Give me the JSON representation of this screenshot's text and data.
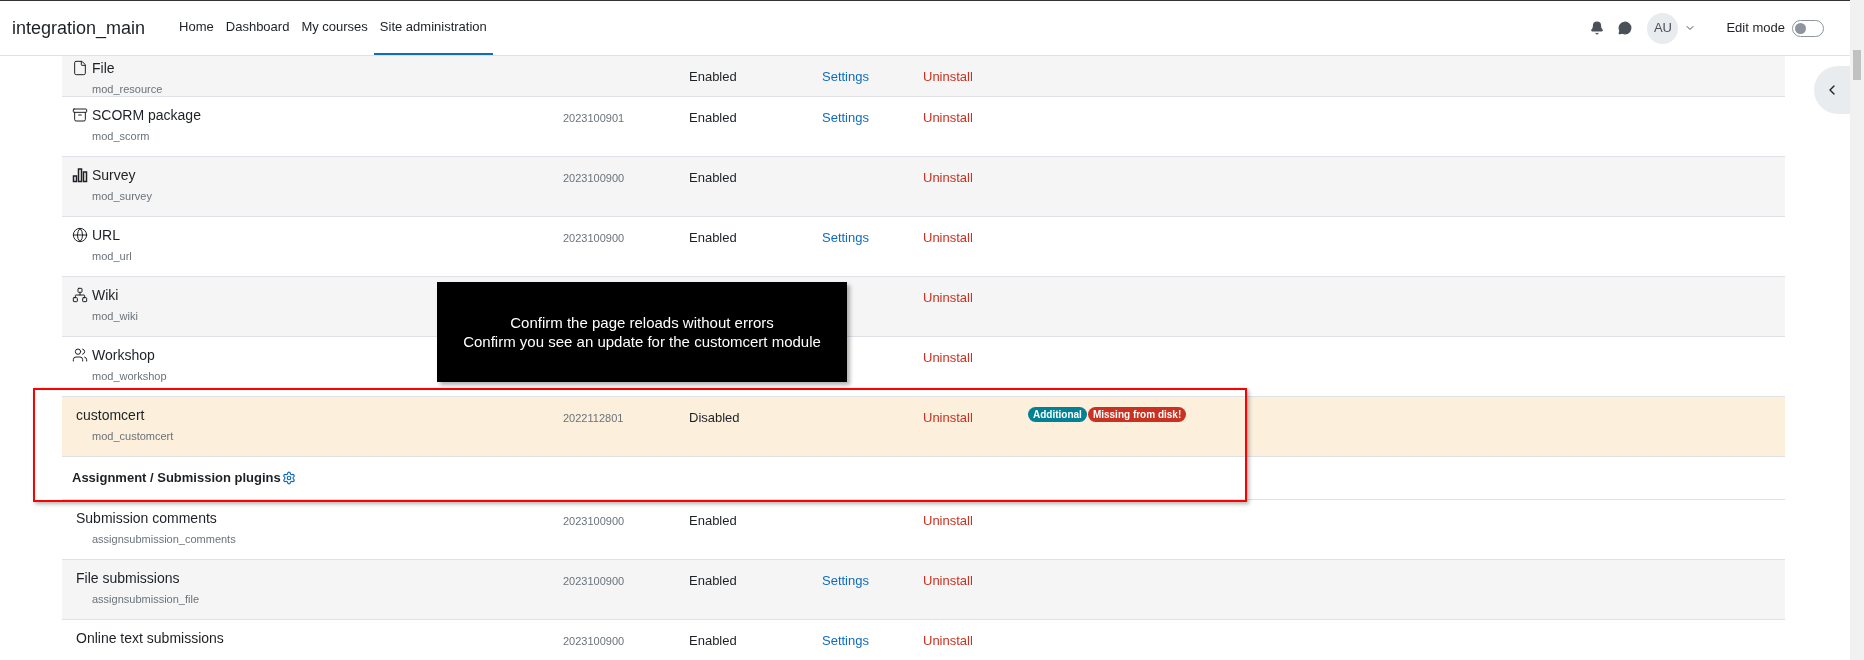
{
  "navbar": {
    "brand": "integration_main",
    "links": [
      {
        "label": "Home",
        "selected": false
      },
      {
        "label": "Dashboard",
        "selected": false
      },
      {
        "label": "My courses",
        "selected": false
      },
      {
        "label": "Site administration",
        "selected": true
      }
    ],
    "avatar": "AU",
    "edit_mode": {
      "label": "Edit mode",
      "on": false
    }
  },
  "rows": [
    {
      "kind": "file",
      "name": "File",
      "component": "mod_resource",
      "status": "Enabled",
      "settings": "Settings",
      "uninstall": "Uninstall",
      "highlighted": false
    },
    {
      "kind": "package",
      "name": "SCORM package",
      "component": "mod_scorm",
      "version": "2023100901",
      "status": "Enabled",
      "settings": "Settings",
      "uninstall": "Uninstall",
      "highlighted": false
    },
    {
      "kind": "survey",
      "name": "Survey",
      "component": "mod_survey",
      "version": "2023100900",
      "status": "Enabled",
      "uninstall": "Uninstall",
      "highlighted": false
    },
    {
      "kind": "url",
      "name": "URL",
      "component": "mod_url",
      "version": "2023100900",
      "status": "Enabled",
      "settings": "Settings",
      "uninstall": "Uninstall",
      "highlighted": false
    },
    {
      "kind": "wiki",
      "name": "Wiki",
      "component": "mod_wiki",
      "uninstall": "Uninstall",
      "highlighted": false
    },
    {
      "kind": "workshop",
      "name": "Workshop",
      "component": "mod_workshop",
      "uninstall": "Uninstall",
      "highlighted": false
    },
    {
      "kind": "plugin",
      "name": "customcert",
      "component": "mod_customcert",
      "version": "2022112801",
      "status": "Disabled",
      "uninstall": "Uninstall",
      "highlighted": true,
      "badges": [
        {
          "label": "Additional",
          "color": "#008196"
        },
        {
          "label": "Missing from disk!",
          "color": "#ca3120"
        }
      ]
    },
    {
      "kind": "heading",
      "label": "Assignment / Submission plugins"
    },
    {
      "kind": "plugin",
      "name": "Submission comments",
      "component": "assignsubmission_comments",
      "version": "2023100900",
      "status": "Enabled",
      "uninstall": "Uninstall",
      "highlighted": false
    },
    {
      "kind": "plugin",
      "name": "File submissions",
      "component": "assignsubmission_file",
      "version": "2023100900",
      "status": "Enabled",
      "settings": "Settings",
      "uninstall": "Uninstall",
      "highlighted": false
    },
    {
      "kind": "plugin",
      "name": "Online text submissions",
      "version": "2023100900",
      "status": "Enabled",
      "settings": "Settings",
      "uninstall": "Uninstall",
      "highlighted": false
    }
  ],
  "note": {
    "lines": [
      "Confirm the page reloads without errors",
      "Confirm you see an update for the customcert module"
    ]
  }
}
